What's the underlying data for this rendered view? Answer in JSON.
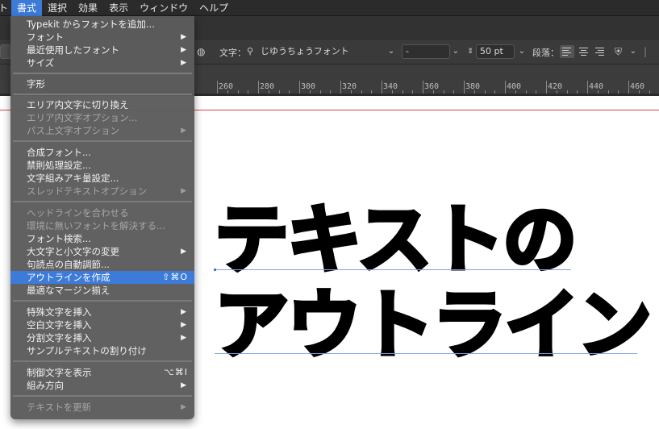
{
  "menubar": {
    "items": [
      {
        "label": "ト",
        "active": false
      },
      {
        "label": "書式",
        "active": true
      },
      {
        "label": "選択",
        "active": false
      },
      {
        "label": "効果",
        "active": false
      },
      {
        "label": "表示",
        "active": false
      },
      {
        "label": "ウィンドウ",
        "active": false
      },
      {
        "label": "ヘルプ",
        "active": false
      }
    ]
  },
  "menu": {
    "items": [
      {
        "label": "Typekit からフォントを追加...",
        "enabled": true
      },
      {
        "label": "フォント",
        "enabled": true,
        "submenu": true
      },
      {
        "label": "最近使用したフォント",
        "enabled": true,
        "submenu": true
      },
      {
        "label": "サイズ",
        "enabled": true,
        "submenu": true
      },
      {
        "label": "字形",
        "enabled": true
      },
      {
        "label": "エリア内文字に切り換え",
        "enabled": true
      },
      {
        "label": "エリア内文字オプション...",
        "enabled": false
      },
      {
        "label": "パス上文字オプション",
        "enabled": false,
        "submenu": true
      },
      {
        "label": "合成フォント...",
        "enabled": true
      },
      {
        "label": "禁則処理設定...",
        "enabled": true
      },
      {
        "label": "文字組みアキ量設定...",
        "enabled": true
      },
      {
        "label": "スレッドテキストオプション",
        "enabled": false,
        "submenu": true
      },
      {
        "label": "ヘッドラインを合わせる",
        "enabled": false
      },
      {
        "label": "環境に無いフォントを解決する...",
        "enabled": false
      },
      {
        "label": "フォント検索...",
        "enabled": true
      },
      {
        "label": "大文字と小文字の変更",
        "enabled": true,
        "submenu": true
      },
      {
        "label": "句読点の自動調節...",
        "enabled": true
      },
      {
        "label": "アウトラインを作成",
        "enabled": true,
        "highlighted": true,
        "shortcut": "⇧⌘O"
      },
      {
        "label": "最適なマージン揃え",
        "enabled": true
      },
      {
        "label": "特殊文字を挿入",
        "enabled": true,
        "submenu": true
      },
      {
        "label": "空白文字を挿入",
        "enabled": true,
        "submenu": true
      },
      {
        "label": "分割文字を挿入",
        "enabled": true,
        "submenu": true
      },
      {
        "label": "サンプルテキストの割り付け",
        "enabled": true
      },
      {
        "label": "制御文字を表示",
        "enabled": true,
        "shortcut": "⌥⌘I"
      },
      {
        "label": "組み方向",
        "enabled": true,
        "submenu": true
      },
      {
        "label": "テキストを更新",
        "enabled": false,
        "submenu": true
      }
    ]
  },
  "controlbar": {
    "char_label": "文字：",
    "font_search_icon": "search-icon",
    "font_name": "じゆうちょうフォント",
    "font_style": "-",
    "font_size": "50 pt",
    "paragraph_label": "段落："
  },
  "ruler": {
    "labels": [
      "260",
      "280",
      "300",
      "320",
      "340",
      "360",
      "380",
      "400",
      "420",
      "440",
      "460"
    ]
  },
  "canvas": {
    "line1": "テキストの",
    "line2": "アウトライン"
  },
  "colors": {
    "menu_highlight": "#3d7bd9",
    "artboard_edge": "#d64545",
    "baseline": "#7fa4e6"
  }
}
